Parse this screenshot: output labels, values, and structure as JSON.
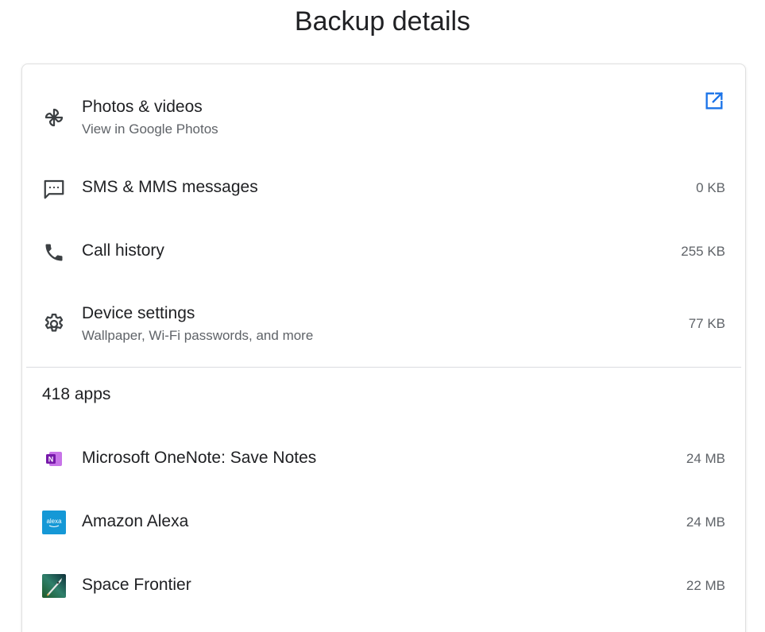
{
  "page_title": "Backup details",
  "colors": {
    "link_blue": "#1a73e8",
    "onenote_purple": "#7719aa",
    "alexa_blue": "#1598d6",
    "text_primary": "#202124",
    "text_secondary": "#5f6368"
  },
  "items": [
    {
      "title": "Photos & videos",
      "subtitle": "View in Google Photos",
      "icon": "pinwheel-icon",
      "action_icon": "open-in-new-icon"
    },
    {
      "title": "SMS & MMS messages",
      "size": "0 KB",
      "icon": "message-icon"
    },
    {
      "title": "Call history",
      "size": "255 KB",
      "icon": "phone-icon"
    },
    {
      "title": "Device settings",
      "subtitle": "Wallpaper, Wi-Fi passwords, and more",
      "size": "77 KB",
      "icon": "gear-icon"
    }
  ],
  "apps": {
    "count_label": "418 apps",
    "list": [
      {
        "name": "Microsoft OneNote: Save Notes",
        "size": "24 MB",
        "icon": "onenote-icon"
      },
      {
        "name": "Amazon Alexa",
        "size": "24 MB",
        "icon": "alexa-icon",
        "icon_text": "alexa"
      },
      {
        "name": "Space Frontier",
        "size": "22 MB",
        "icon": "space-frontier-icon"
      }
    ]
  }
}
